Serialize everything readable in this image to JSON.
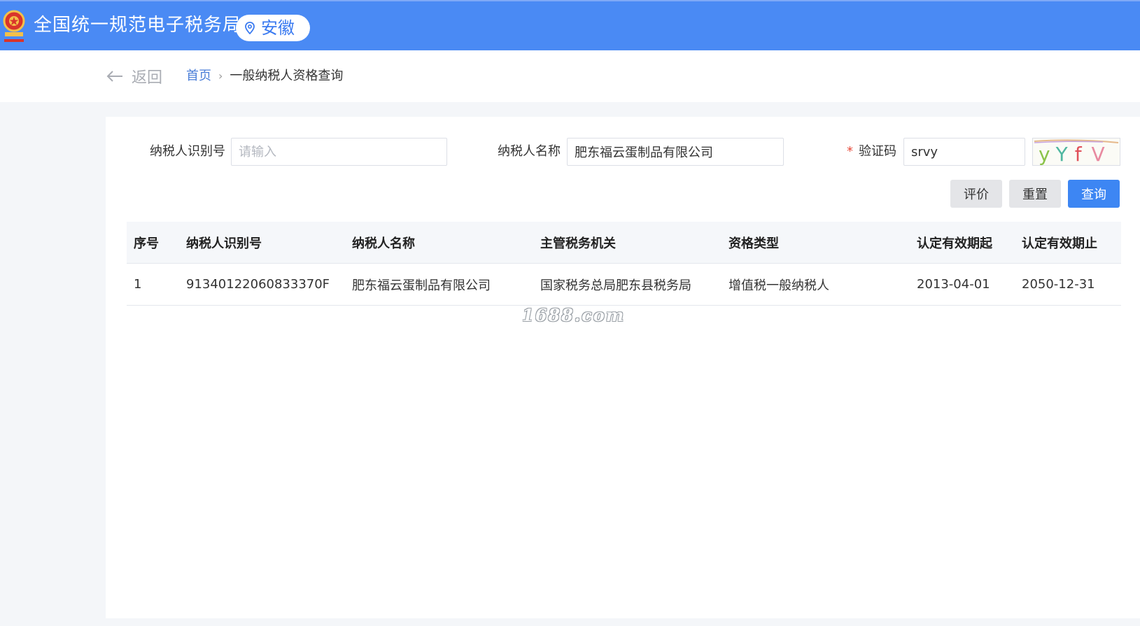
{
  "header": {
    "title": "全国统一规范电子税务局",
    "region": "安徽"
  },
  "nav": {
    "back_label": "返回",
    "breadcrumb_home": "首页",
    "breadcrumb_separator": "›",
    "breadcrumb_current": "一般纳税人资格查询"
  },
  "form": {
    "taxpayer_id_label": "纳税人识别号",
    "taxpayer_id_placeholder": "请输入",
    "taxpayer_id_value": "",
    "taxpayer_name_label": "纳税人名称",
    "taxpayer_name_value": "肥东福云蛋制品有限公司",
    "captcha_required_mark": "*",
    "captcha_label": "验证码",
    "captcha_value": "srvy",
    "captcha_image_text": "yYfV"
  },
  "buttons": {
    "evaluate": "评价",
    "reset": "重置",
    "query": "查询"
  },
  "table": {
    "columns": [
      "序号",
      "纳税人识别号",
      "纳税人名称",
      "主管税务机关",
      "资格类型",
      "认定有效期起",
      "认定有效期止"
    ],
    "rows": [
      [
        "1",
        "91340122060833370F",
        "肥东福云蛋制品有限公司",
        "国家税务总局肥东县税务局",
        "增值税一般纳税人",
        "2013-04-01",
        "2050-12-31"
      ]
    ]
  },
  "watermark": "1688.com",
  "colors": {
    "header_bg": "#4a8af4",
    "primary_button": "#3d86f3",
    "link": "#4a7ed8",
    "required": "#e74c3c"
  }
}
